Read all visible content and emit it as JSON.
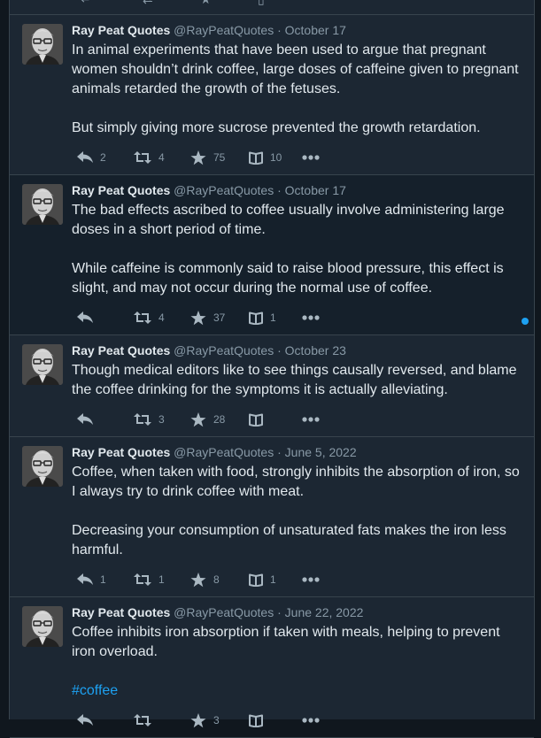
{
  "colors": {
    "background": "#10171e",
    "column": "#1c2733",
    "unread_row": "#15202b",
    "accent": "#1da1f2",
    "muted": "#8899a6",
    "text": "#e1e8ed"
  },
  "icons": {
    "reply": "reply-icon",
    "retweet": "retweet-icon",
    "like": "star-icon",
    "save": "book-icon",
    "more": "more-icon",
    "unread": "unread-dot"
  },
  "tweets": [
    {
      "name": "Ray Peat Quotes",
      "handle": "@RayPeatQuotes",
      "sep": "·",
      "date": "October 17",
      "paragraphs": [
        "In animal experiments that have been used to argue that pregnant women shouldn’t drink coffee, large doses of caffeine given to pregnant animals retarded the growth of the fetuses.",
        "But simply giving more sucrose prevented the growth retardation."
      ],
      "reply_count": "2",
      "retweet_count": "4",
      "like_count": "75",
      "save_count": "10"
    },
    {
      "name": "Ray Peat Quotes",
      "handle": "@RayPeatQuotes",
      "sep": "·",
      "date": "October 17",
      "paragraphs": [
        "The bad effects ascribed to coffee usually involve administering large doses in a short period of time.",
        "While caffeine is commonly said to raise blood pressure, this effect is slight, and may not occur during the normal use of coffee."
      ],
      "reply_count": "",
      "retweet_count": "4",
      "like_count": "37",
      "save_count": "1"
    },
    {
      "name": "Ray Peat Quotes",
      "handle": "@RayPeatQuotes",
      "sep": "·",
      "date": "October 23",
      "paragraphs": [
        "Though medical editors like to see things causally reversed, and blame the coffee drinking for the symptoms it is actually alleviating."
      ],
      "reply_count": "",
      "retweet_count": "3",
      "like_count": "28",
      "save_count": ""
    },
    {
      "name": "Ray Peat Quotes",
      "handle": "@RayPeatQuotes",
      "sep": "·",
      "date": "June 5, 2022",
      "paragraphs": [
        "Coffee, when taken with food, strongly inhibits the absorption of iron, so I always try to drink coffee with meat.",
        "Decreasing your consumption of unsaturated fats makes the iron less harmful."
      ],
      "reply_count": "1",
      "retweet_count": "1",
      "like_count": "8",
      "save_count": "1"
    },
    {
      "name": "Ray Peat Quotes",
      "handle": "@RayPeatQuotes",
      "sep": "·",
      "date": "June 22, 2022",
      "paragraphs": [
        "Coffee inhibits iron absorption if taken with meals, helping to prevent iron overload."
      ],
      "hashtag": "#coffee",
      "reply_count": "",
      "retweet_count": "",
      "like_count": "3",
      "save_count": ""
    }
  ]
}
